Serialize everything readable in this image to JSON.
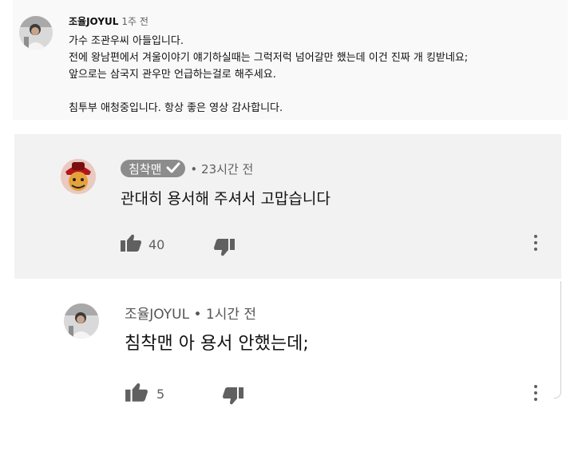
{
  "top_comment": {
    "author": "조율JOYUL",
    "time": "1주 전",
    "lines": [
      "가수 조관우씨 아들입니다.",
      "전에 왕남편에서 겨울이야기 얘기하실때는 그럭저럭 넘어갈만 했는데 이건 진짜 개 킹받네요;",
      "앞으로는 삼국지 관우만 언급하는걸로 해주세요.",
      "",
      "침투부 애청중입니다. 항상 좋은 영상 감사합니다."
    ]
  },
  "reply1": {
    "author": "침착맨",
    "verified_icon": "check-icon",
    "time": "• 23시간 전",
    "text": "관대히 용서해 주셔서 고맙습니다",
    "likes": "40"
  },
  "reply2": {
    "author": "조율JOYUL • 1시간 전",
    "text": "침착맨 아 용서 안했는데;",
    "likes": "5"
  },
  "icons": {
    "like": "thumbs-up-icon",
    "dislike": "thumbs-down-icon",
    "more": "more-vert-icon"
  }
}
